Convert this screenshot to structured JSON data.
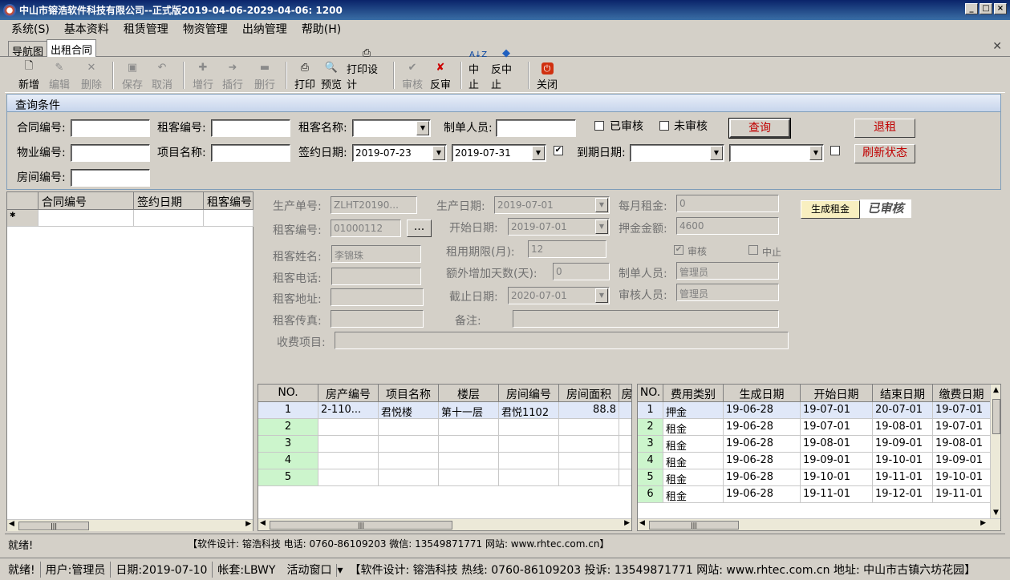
{
  "window": {
    "title": "中山市镕浩软件科技有限公司--正式版2019-04-06-2029-04-06: 1200"
  },
  "menu": [
    "系统(S)",
    "基本资料",
    "租赁管理",
    "物资管理",
    "出纳管理",
    "帮助(H)"
  ],
  "tabs": [
    "导航图",
    "出租合同"
  ],
  "toolbar": [
    {
      "label": "新增",
      "icon": "new-file-icon",
      "enabled": true
    },
    {
      "label": "编辑",
      "icon": "edit-icon",
      "enabled": false
    },
    {
      "label": "删除",
      "icon": "delete-icon",
      "enabled": false
    },
    {
      "label": "保存",
      "icon": "save-icon",
      "enabled": false
    },
    {
      "label": "取消",
      "icon": "undo-icon",
      "enabled": false
    },
    {
      "label": "增行",
      "icon": "add-row-icon",
      "enabled": false
    },
    {
      "label": "插行",
      "icon": "insert-row-icon",
      "enabled": false
    },
    {
      "label": "删行",
      "icon": "delete-row-icon",
      "enabled": false
    },
    {
      "label": "打印",
      "icon": "print-icon",
      "enabled": true
    },
    {
      "label": "预览",
      "icon": "preview-icon",
      "enabled": true
    },
    {
      "label": "打印设计",
      "icon": "print-design-icon",
      "enabled": true
    },
    {
      "label": "审核",
      "icon": "approve-icon",
      "enabled": false
    },
    {
      "label": "反审",
      "icon": "unapprove-icon",
      "enabled": true
    },
    {
      "label": "中止",
      "icon": "sort-icon",
      "enabled": true
    },
    {
      "label": "反中止",
      "icon": "resume-icon",
      "enabled": true
    },
    {
      "label": "关闭",
      "icon": "close-icon",
      "enabled": true
    }
  ],
  "query": {
    "title": "查询条件",
    "contract_no_label": "合同编号:",
    "tenant_no_label": "租客编号:",
    "tenant_name_label": "租客名称:",
    "creator_label": "制单人员:",
    "approved_label": "已审核",
    "unapproved_label": "未审核",
    "query_btn": "查询",
    "return_btn": "退租",
    "property_no_label": "物业编号:",
    "project_label": "项目名称:",
    "sign_date_label": "签约日期:",
    "sign_from": "2019-07-23",
    "sign_to": "2019-07-31",
    "expire_label": "到期日期:",
    "refresh_btn": "刷新状态",
    "room_no_label": "房间编号:"
  },
  "left_grid": {
    "headers": [
      "合同编号",
      "签约日期",
      "租客编号"
    ]
  },
  "detail": {
    "prod_no_label": "生产单号:",
    "prod_no": "ZLHT20190...",
    "prod_date_label": "生产日期:",
    "prod_date": "2019-07-01",
    "monthly_rent_label": "每月租金:",
    "monthly_rent": "0",
    "gen_rent_btn": "生成租金",
    "stamp": "已审核",
    "tenant_no_label": "租客编号:",
    "tenant_no": "01000112",
    "ellipsis": "...",
    "start_date_label": "开始日期:",
    "start_date": "2019-07-01",
    "deposit_label": "押金金额:",
    "deposit": "4600",
    "term_label": "租用期限(月):",
    "term": "12",
    "approve_chk": "审核",
    "stop_chk": "中止",
    "tenant_name_label": "租客姓名:",
    "tenant_name": "李锦珠",
    "extra_days_label": "额外增加天数(天):",
    "extra_days": "0",
    "creator_label": "制单人员:",
    "creator": "管理员",
    "phone_label": "租客电话:",
    "address_label": "租客地址:",
    "end_date_label": "截止日期:",
    "end_date": "2020-07-01",
    "approver_label": "审核人员:",
    "approver": "管理员",
    "fax_label": "租客传真:",
    "remark_label": "备注:",
    "fee_items_label": "收费项目:"
  },
  "room_grid": {
    "headers": [
      "NO.",
      "房产编号",
      "项目名称",
      "楼层",
      "房间编号",
      "房间面积",
      "房"
    ],
    "rows": [
      [
        "1",
        "2-110...",
        "君悦楼",
        "第十一层",
        "君悦1102",
        "88.8",
        ""
      ],
      [
        "2",
        "",
        "",
        "",
        "",
        "",
        ""
      ],
      [
        "3",
        "",
        "",
        "",
        "",
        "",
        ""
      ],
      [
        "4",
        "",
        "",
        "",
        "",
        "",
        ""
      ],
      [
        "5",
        "",
        "",
        "",
        "",
        "",
        ""
      ]
    ]
  },
  "fee_grid": {
    "headers": [
      "NO.",
      "费用类别",
      "生成日期",
      "开始日期",
      "结束日期",
      "缴费日期"
    ],
    "rows": [
      [
        "1",
        "押金",
        "19-06-28",
        "19-07-01",
        "20-07-01",
        "19-07-01"
      ],
      [
        "2",
        "租金",
        "19-06-28",
        "19-07-01",
        "19-08-01",
        "19-07-01"
      ],
      [
        "3",
        "租金",
        "19-06-28",
        "19-08-01",
        "19-09-01",
        "19-08-01"
      ],
      [
        "4",
        "租金",
        "19-06-28",
        "19-09-01",
        "19-10-01",
        "19-09-01"
      ],
      [
        "5",
        "租金",
        "19-06-28",
        "19-10-01",
        "19-11-01",
        "19-10-01"
      ],
      [
        "6",
        "租金",
        "19-06-28",
        "19-11-01",
        "19-12-01",
        "19-11-01"
      ]
    ]
  },
  "status1": {
    "ready": "就绪!",
    "info": "【软件设计: 镕浩科技 电话: 0760-86109203 微信: 13549871771 网站: www.rhtec.com.cn】"
  },
  "status2": {
    "ready": "就绪!",
    "user": "用户:管理员",
    "date": "日期:2019-07-10",
    "account": "帐套:LBWY",
    "window": "活动窗口",
    "info": "【软件设计: 镕浩科技 热线: 0760-86109203 投诉: 13549871771 网站: www.rhtec.com.cn 地址: 中山市古镇六坊花园】"
  }
}
